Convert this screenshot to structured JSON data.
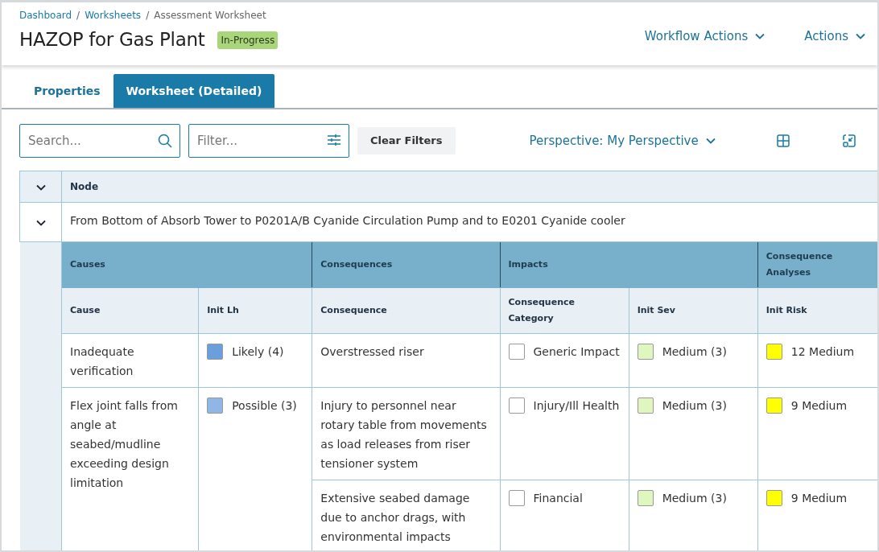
{
  "breadcrumb": [
    {
      "label": "Dashboard",
      "kind": "link"
    },
    {
      "label": "/",
      "kind": "separator"
    },
    {
      "label": "Worksheets",
      "kind": "link"
    },
    {
      "label": "/",
      "kind": "separator"
    },
    {
      "label": "Assessment Worksheet",
      "kind": "current"
    }
  ],
  "title": "HAZOP for Gas Plant",
  "status_badge": "In-Progress",
  "header_actions": [
    "Workflow Actions",
    "Actions"
  ],
  "tabs": [
    {
      "label": "Properties",
      "selected": false
    },
    {
      "label": "Worksheet (Detailed)",
      "selected": true
    }
  ],
  "toolbar": {
    "search": {
      "placeholder": "Search..."
    },
    "filter": {
      "placeholder": "Filter..."
    },
    "clear_button": "Clear Filters",
    "perspective": "Perspective: My Perspective"
  },
  "table": {
    "node_header": "Node",
    "node": {
      "label": "From Bottom of Absorb Tower to P0201A/B Cyanide Circulation Pump and to E0201 Cyanide cooler",
      "expanded": true
    },
    "groups": [
      {
        "label": "Causes",
        "columns": [
          "Cause",
          "Init Lh"
        ]
      },
      {
        "label": "Consequences",
        "columns": [
          "Consequence"
        ]
      },
      {
        "label": "Impacts",
        "columns": [
          "Consequence Category",
          "Init Sev"
        ]
      },
      {
        "label": "Consequence Analyses",
        "columns": [
          "Init Risk"
        ]
      }
    ],
    "causes": [
      {
        "cause": "Inadequate verification",
        "init_lh": {
          "label": "Likely (4)",
          "color": "#6a9fdc"
        },
        "consequences": [
          {
            "consequence": "Overstressed riser",
            "category": {
              "label": "Generic Impact",
              "color": "#ffffff"
            },
            "init_sev": {
              "label": "Medium (3)",
              "color": "#dff7bf"
            },
            "init_risk": {
              "label": "12 Medium",
              "color": "#ffff00"
            }
          }
        ]
      },
      {
        "cause": "Flex joint falls from angle at seabed/mudline exceeding design limitation",
        "init_lh": {
          "label": "Possible (3)",
          "color": "#8fb6e6"
        },
        "consequences": [
          {
            "consequence": "Injury to personnel near rotary table from movements as load releases from riser tensioner system",
            "category": {
              "label": "Injury/Ill Health",
              "color": "#ffffff"
            },
            "init_sev": {
              "label": "Medium (3)",
              "color": "#dff7bf"
            },
            "init_risk": {
              "label": "9 Medium",
              "color": "#ffff00"
            }
          },
          {
            "consequence": "Extensive seabed damage due to anchor drags, with environmental impacts",
            "category": {
              "label": "Financial",
              "color": "#ffffff"
            },
            "init_sev": {
              "label": "Medium (3)",
              "color": "#dff7bf"
            },
            "init_risk": {
              "label": "9 Medium",
              "color": "#ffff00"
            }
          }
        ]
      }
    ]
  }
}
